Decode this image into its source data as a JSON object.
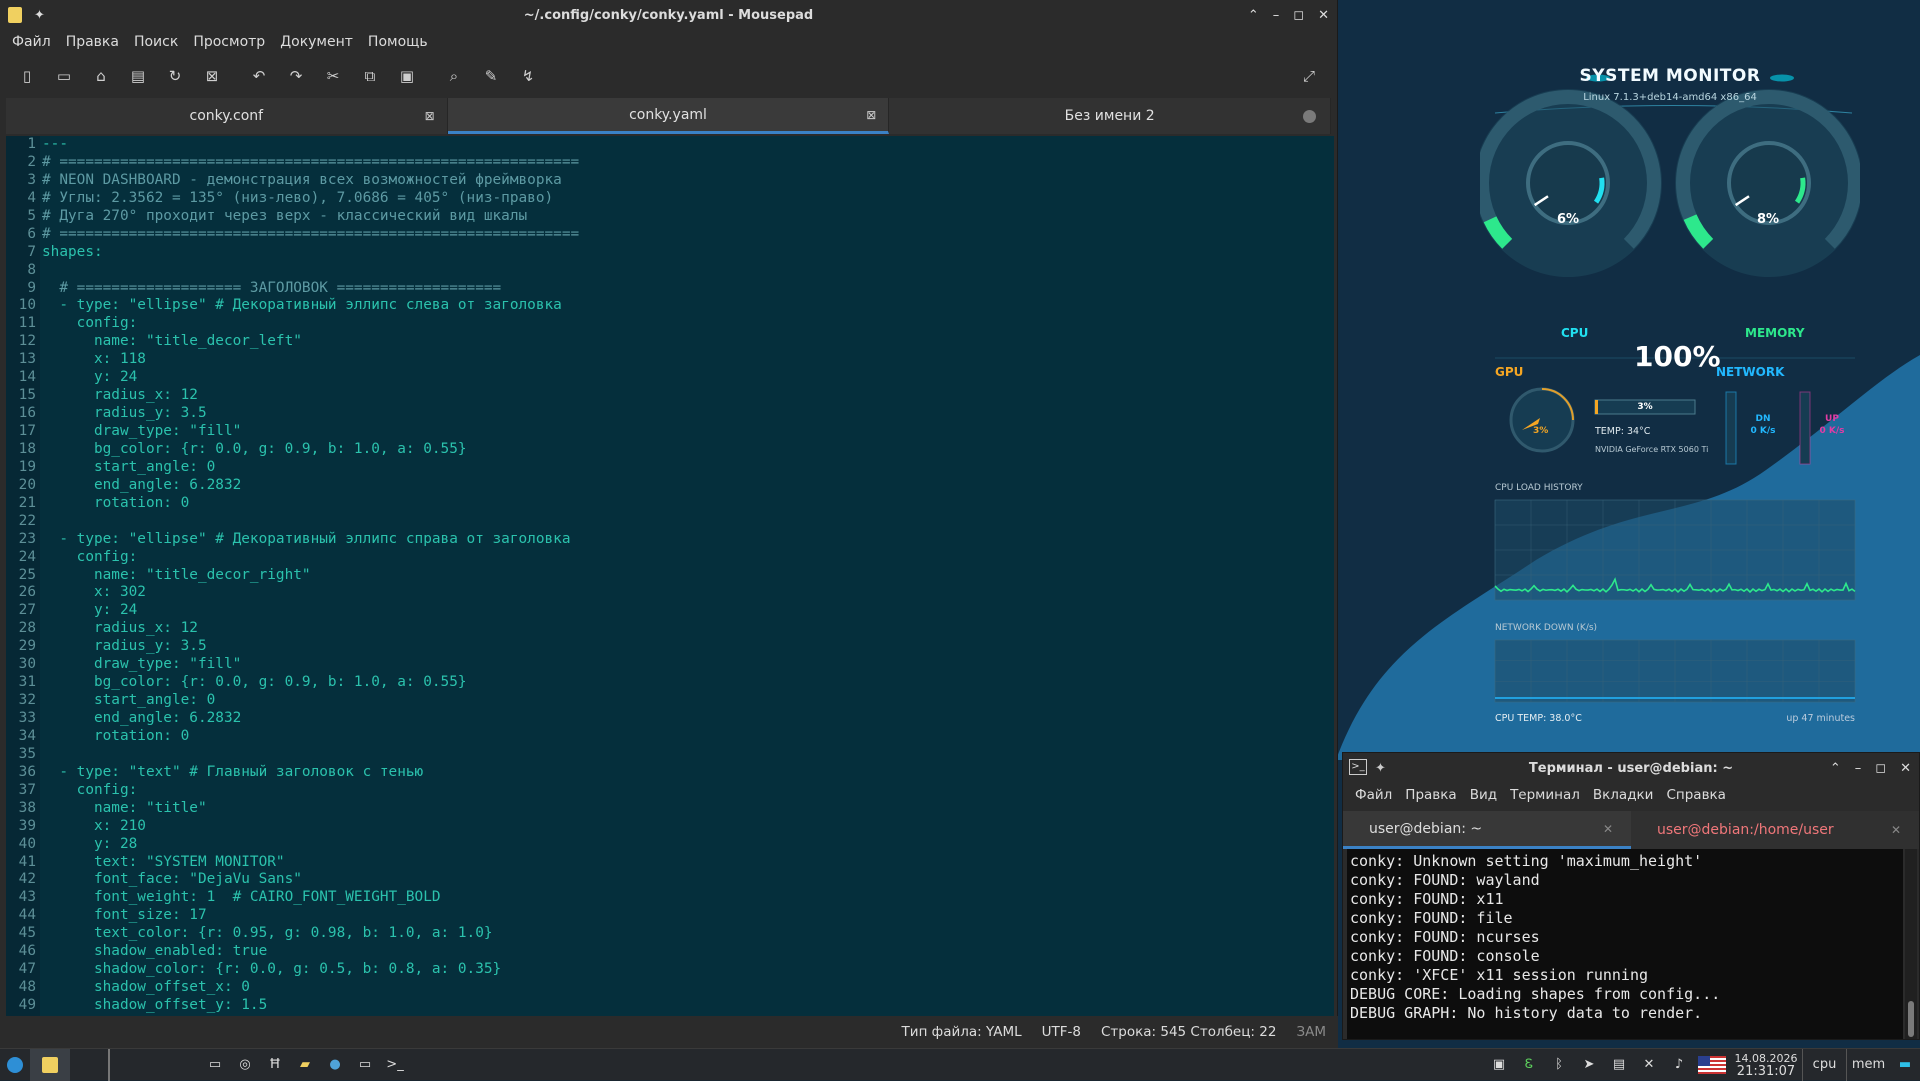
{
  "editor": {
    "title": "~/.config/conky/conky.yaml - Mousepad",
    "menu": [
      "Файл",
      "Правка",
      "Поиск",
      "Просмотр",
      "Документ",
      "Помощь"
    ],
    "toolbar_icons": [
      "new-document-icon",
      "open-icon",
      "lock-icon",
      "print-icon",
      "reload-icon",
      "close-document-icon",
      "undo-icon",
      "redo-icon",
      "cut-icon",
      "copy-icon",
      "paste-icon",
      "find-icon",
      "find-replace-icon",
      "goto-icon"
    ],
    "tabs": [
      {
        "label": "conky.conf",
        "state": "close"
      },
      {
        "label": "conky.yaml",
        "state": "close",
        "active": true
      },
      {
        "label": "Без имени 2",
        "state": "modified"
      }
    ],
    "lines": [
      "---",
      "# ============================================================",
      "# NEON DASHBOARD - демонстрация всех возможностей фреймворка",
      "# Углы: 2.3562 = 135° (низ-лево), 7.0686 = 405° (низ-право)",
      "# Дуга 270° проходит через верх - классический вид шкалы",
      "# ============================================================",
      "shapes:",
      "",
      "  # =================== ЗАГОЛОВОК ===================",
      "  - type: \"ellipse\" # Декоративный эллипс слева от заголовка",
      "    config:",
      "      name: \"title_decor_left\"",
      "      x: 118",
      "      y: 24",
      "      radius_x: 12",
      "      radius_y: 3.5",
      "      draw_type: \"fill\"",
      "      bg_color: {r: 0.0, g: 0.9, b: 1.0, a: 0.55}",
      "      start_angle: 0",
      "      end_angle: 6.2832",
      "      rotation: 0",
      "",
      "  - type: \"ellipse\" # Декоративный эллипс справа от заголовка",
      "    config:",
      "      name: \"title_decor_right\"",
      "      x: 302",
      "      y: 24",
      "      radius_x: 12",
      "      radius_y: 3.5",
      "      draw_type: \"fill\"",
      "      bg_color: {r: 0.0, g: 0.9, b: 1.0, a: 0.55}",
      "      start_angle: 0",
      "      end_angle: 6.2832",
      "      rotation: 0",
      "",
      "  - type: \"text\" # Главный заголовок с тенью",
      "    config:",
      "      name: \"title\"",
      "      x: 210",
      "      y: 28",
      "      text: \"SYSTEM MONITOR\"",
      "      font_face: \"DejaVu Sans\"",
      "      font_weight: 1  # CAIRO_FONT_WEIGHT_BOLD",
      "      font_size: 17",
      "      text_color: {r: 0.95, g: 0.98, b: 1.0, a: 1.0}",
      "      shadow_enabled: true",
      "      shadow_color: {r: 0.0, g: 0.5, b: 0.8, a: 0.35}",
      "      shadow_offset_x: 0",
      "      shadow_offset_y: 1.5"
    ],
    "status": {
      "filetype": "Тип файла: YAML",
      "encoding": "UTF-8",
      "position": "Строка: 545 Столбец: 22",
      "mode": "ЗАМ"
    }
  },
  "conky": {
    "title": "SYSTEM MONITOR",
    "subtitle": "Linux 7.1.3+deb14-amd64 x86_64",
    "cpu_value": "6%",
    "cpu_percent": 6,
    "mem_value": "8%",
    "mem_percent": 8,
    "cpu_label": "CPU",
    "mem_label": "MEMORY",
    "center_value": "100%",
    "gpu_label": "GPU",
    "network_label": "NETWORK",
    "gpu_value": "3%",
    "gpu_bar_value": "3%",
    "gpu_bar_percent": 3,
    "gpu_temp": "TEMP: 34°C",
    "gpu_name": "NVIDIA GeForce RTX 5060 Ti",
    "net_down_label": "DN",
    "net_down_value": "0 K/s",
    "net_up_label": "UP",
    "net_up_value": "0 K/s",
    "cpu_history_label": "CPU LOAD HISTORY",
    "net_history_label": "NETWORK DOWN (K/s)",
    "cpu_temp": "CPU TEMP: 38.0°C",
    "uptime": "up 47 minutes",
    "colors": {
      "cpu": "#21e0f0",
      "mem": "#2de88c",
      "gpu": "#f5a623",
      "net": "#22b8ff",
      "up": "#e23ca5"
    }
  },
  "terminal": {
    "title": "Терминал - user@debian: ~",
    "menu": [
      "Файл",
      "Правка",
      "Вид",
      "Терминал",
      "Вкладки",
      "Справка"
    ],
    "tabs": [
      "user@debian: ~",
      "user@debian:/home/user"
    ],
    "output": [
      "conky: Unknown setting 'maximum_height'",
      "conky: FOUND: wayland",
      "conky: FOUND: x11",
      "conky: FOUND: file",
      "conky: FOUND: ncurses",
      "conky: FOUND: console",
      "conky: 'XFCE' x11 session running",
      "DEBUG CORE: Loading shapes from config...",
      "DEBUG GRAPH: No history data to render.",
      "_"
    ]
  },
  "taskbar": {
    "date": "14.08.2026",
    "time": "21:31:07",
    "cpu": "cpu",
    "mem": "mem"
  }
}
